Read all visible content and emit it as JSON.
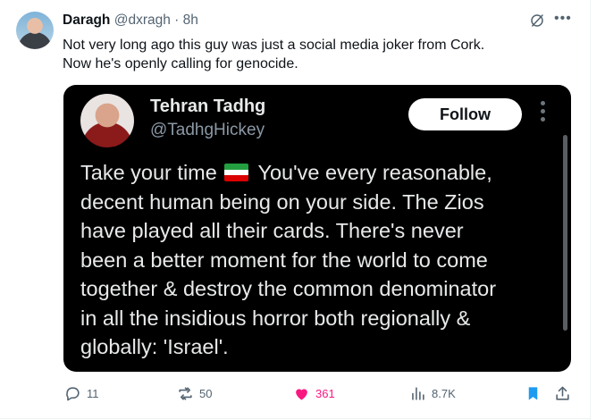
{
  "tweet": {
    "author_name": "Daragh",
    "author_handle": "@dxragh",
    "separator": "·",
    "time": "8h",
    "text_lines": [
      "Not very long ago this guy was just a social media joker from Cork.",
      "Now he's openly calling for genocide."
    ],
    "icons": {
      "more": "more-horizontal-icon",
      "grok": "grok-icon",
      "avatar": "profile-photo"
    }
  },
  "embedded_card": {
    "name": "Tehran Tadhg",
    "handle": "@TadhgHickey",
    "follow_label": "Follow",
    "text_lines": [
      {
        "before": "Take your time",
        "flag": "iran-flag-emoji",
        "after": "You've every reasonable,"
      },
      {
        "text": "decent human being on your side. The Zios"
      },
      {
        "text": "have played all their cards. There's never"
      },
      {
        "text": "been a better moment for the world to come"
      },
      {
        "text": "together & destroy the common denominator"
      },
      {
        "text": "in all the insidious horror both regionally &"
      },
      {
        "text": "globally: 'Israel'."
      }
    ],
    "flag_colors": [
      "#239f40",
      "#ffffff",
      "#da0000"
    ]
  },
  "actions": {
    "replies": "11",
    "reposts": "50",
    "likes": "361",
    "views": "8.7K",
    "liked": true,
    "bookmarked": true,
    "colors": {
      "like": "#f91880",
      "bookmark": "#1d9bf0",
      "muted": "#536471"
    }
  }
}
